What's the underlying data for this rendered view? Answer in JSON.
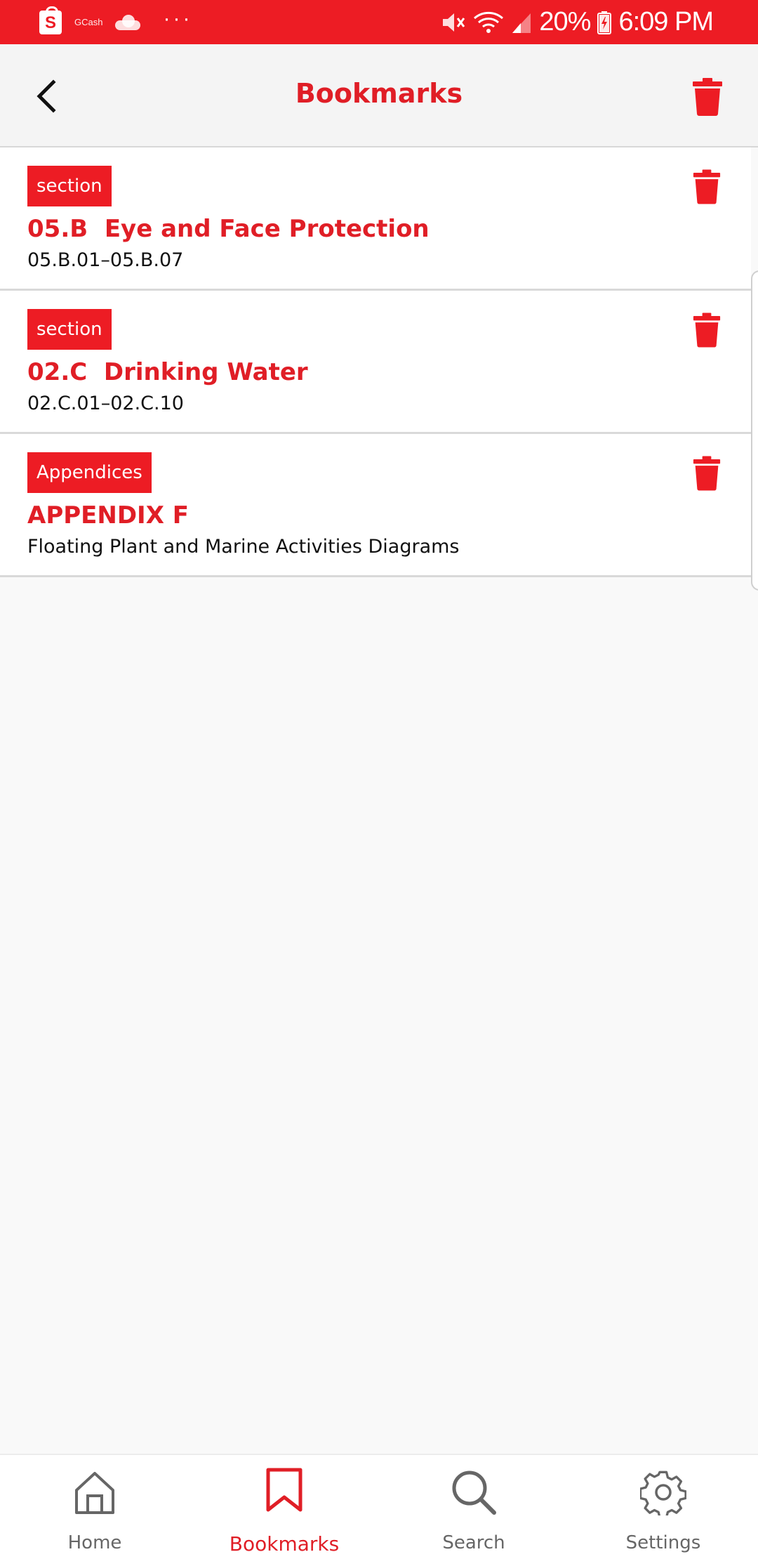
{
  "status_bar": {
    "gcash_label": "GCash",
    "battery": "20%",
    "time": "6:09 PM"
  },
  "app_bar": {
    "title": "Bookmarks",
    "back_icon": "chevron-left-icon",
    "clear_icon": "trash-icon"
  },
  "bookmarks": [
    {
      "tag": "section",
      "title": "05.B  Eye and Face Protection",
      "subtitle": "05.B.01–05.B.07"
    },
    {
      "tag": "section",
      "title": "02.C  Drinking Water",
      "subtitle": "02.C.01–02.C.10"
    },
    {
      "tag": "Appendices",
      "title": "APPENDIX F",
      "subtitle": "Floating Plant and Marine Activities Diagrams"
    }
  ],
  "bottom_nav": {
    "items": [
      {
        "label": "Home",
        "icon": "home-icon",
        "active": false
      },
      {
        "label": "Bookmarks",
        "icon": "bookmark-icon",
        "active": true
      },
      {
        "label": "Search",
        "icon": "search-icon",
        "active": false
      },
      {
        "label": "Settings",
        "icon": "gear-icon",
        "active": false
      }
    ]
  },
  "colors": {
    "accent": "#ed1c24",
    "title_red": "#e01e26",
    "background": "#f9f9f9"
  }
}
